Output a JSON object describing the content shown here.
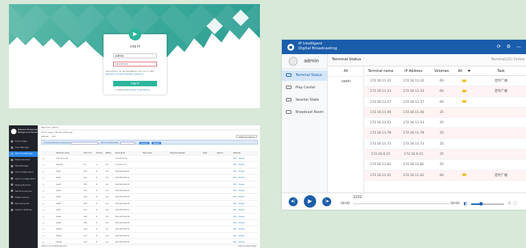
{
  "login": {
    "title": "Log In",
    "username_value": "admin",
    "password_value": "••••••••",
    "hint_text": "Instructions: To use NaviNet ts: 16:7 to 4 x ft/tv",
    "hint_link": "Operation Guide",
    "forgot_link": "Forgotten password",
    "login_button": "Log In",
    "remember_label": "Always",
    "remember_link": "Remember & Recognize",
    "logo_icon": "speaker-icon"
  },
  "admin_web": {
    "brand": "Network Broadcast Background Server",
    "topbar": "Welcome, admin",
    "breadcrumb": "Home page / Terminal Manage",
    "tools": {
      "refresh": "Refresh",
      "add": "Add",
      "right_button": "Filter by region"
    },
    "filter": {
      "label_group": "Comprehensive Selection",
      "label_name": "Terminal Number",
      "search_button": "Query",
      "reset_button": "Reset"
    },
    "menu": [
      "Home page",
      "User Manage",
      "Terminal Manage",
      "Media Number",
      "Task Manage",
      "Call Configuration",
      "Alarm Configuration",
      "Paging Number",
      "Terminal service",
      "Media Library",
      "Recording list",
      "System Settings"
    ],
    "active_menu_index": 2,
    "columns": [
      "",
      "Terminal name",
      "Call num",
      "Volume",
      "Status",
      "Terminal IP",
      "Task name",
      "Physical address",
      "Type",
      "Version",
      "Operate"
    ],
    "rows": [
      [
        "",
        "172.16.11.22",
        "",
        "",
        "",
        "172.16.11.22",
        "",
        "",
        "",
        "",
        ""
      ],
      [
        "",
        "Default",
        "10",
        "4",
        "1/2",
        "172.16.11.2",
        "",
        "",
        "",
        "",
        ""
      ],
      [
        "",
        "test1",
        "101",
        "8",
        "1/2",
        "192.168.100.21",
        "",
        "",
        "",
        "",
        ""
      ],
      [
        "",
        "Test2",
        "102",
        "8",
        "1/2",
        "192.168.100.22",
        "",
        "",
        "",
        "",
        ""
      ],
      [
        "",
        "test3",
        "103",
        "8",
        "1/2",
        "192.168.100.23",
        "",
        "",
        "",
        "",
        ""
      ],
      [
        "",
        "test4",
        "104",
        "8",
        "1/2",
        "192.168.100.24",
        "",
        "",
        "",
        "",
        ""
      ],
      [
        "",
        "test5",
        "105",
        "8",
        "1/2",
        "192.168.100.25",
        "",
        "",
        "",
        "",
        ""
      ],
      [
        "",
        "test6",
        "106",
        "8",
        "1/2",
        "192.168.100.26",
        "",
        "",
        "",
        "",
        ""
      ],
      [
        "",
        "test7",
        "107",
        "8",
        "1/2",
        "192.168.100.27",
        "",
        "",
        "",
        "",
        ""
      ],
      [
        "",
        "test8",
        "108",
        "8",
        "1/2",
        "192.168.100.28",
        "",
        "",
        "",
        "",
        ""
      ],
      [
        "",
        "test9",
        "109",
        "8",
        "1/2",
        "192.168.100.29",
        "",
        "",
        "",
        "",
        ""
      ],
      [
        "",
        "test10",
        "110",
        "8",
        "1/2",
        "192.168.100.30",
        "",
        "",
        "",
        "",
        ""
      ],
      [
        "",
        "test11",
        "111",
        "8",
        "1/2",
        "192.168.100.31",
        "",
        "",
        "",
        "",
        ""
      ],
      [
        "",
        "test12",
        "112",
        "8",
        "1/2",
        "192.168.100.32",
        "",
        "",
        "",
        "",
        ""
      ]
    ],
    "op_edit": "Edit",
    "op_delete": "Delete",
    "footer_left": "Show 1 to 10 Total Records",
    "footer_right": "Previous  Next Page"
  },
  "desktop_app": {
    "title_line1": "IP Intelligent",
    "title_line2": "Digital Broadcasting",
    "window_controls": "⟳ ⚙ —",
    "username": "admin",
    "nav": [
      {
        "label": "Terminal Status",
        "icon": "terminal-icon"
      },
      {
        "label": "Play Center",
        "icon": "play-center-icon"
      },
      {
        "label": "Session State",
        "icon": "session-icon"
      },
      {
        "label": "Broadcast Room",
        "icon": "broadcast-room-icon"
      }
    ],
    "active_nav_index": 0,
    "section_title": "Terminal Status",
    "online_text": "Terminal(21) Online",
    "groups": [
      "All",
      "ceshi"
    ],
    "columns": {
      "name": "Terminal name",
      "ip": "IP Address",
      "volume": "Volumes",
      "status": "All",
      "task": "Task"
    },
    "rows": [
      {
        "name": "172.16.11.22",
        "ip": "172.16.11.22",
        "volume": "60",
        "busy": true,
        "task": "定时广播"
      },
      {
        "name": "172.16.11.33",
        "ip": "172.16.11.33",
        "volume": "60",
        "busy": true,
        "task": "定时广播"
      },
      {
        "name": "172.16.11.37",
        "ip": "172.16.11.37",
        "volume": "60",
        "busy": true,
        "task": ""
      },
      {
        "name": "172.16.11.40",
        "ip": "172.16.11.40",
        "volume": "25",
        "busy": false,
        "task": ""
      },
      {
        "name": "172.16.11.53",
        "ip": "172.16.11.53",
        "volume": "25",
        "busy": false,
        "task": ""
      },
      {
        "name": "172.16.11.78",
        "ip": "172.16.11.78",
        "volume": "25",
        "busy": false,
        "task": ""
      },
      {
        "name": "172.16.11.73",
        "ip": "172.16.11.73",
        "volume": "25",
        "busy": false,
        "task": ""
      },
      {
        "name": "172.16.9.15",
        "ip": "172.16.9.15",
        "volume": "25",
        "busy": false,
        "task": ""
      },
      {
        "name": "172.16.11.81",
        "ip": "172.16.11.81",
        "volume": "25",
        "busy": false,
        "task": ""
      },
      {
        "name": "172.16.11.41",
        "ip": "172.16.11.41",
        "volume": "60",
        "busy": true,
        "task": "定时广播"
      }
    ],
    "player": {
      "song": "2222",
      "time_start": "00:00",
      "time_end": "00:00",
      "volume_level": 0.3
    },
    "colors": {
      "primary": "#1a5dab",
      "status_busy": "#f1c232"
    }
  }
}
